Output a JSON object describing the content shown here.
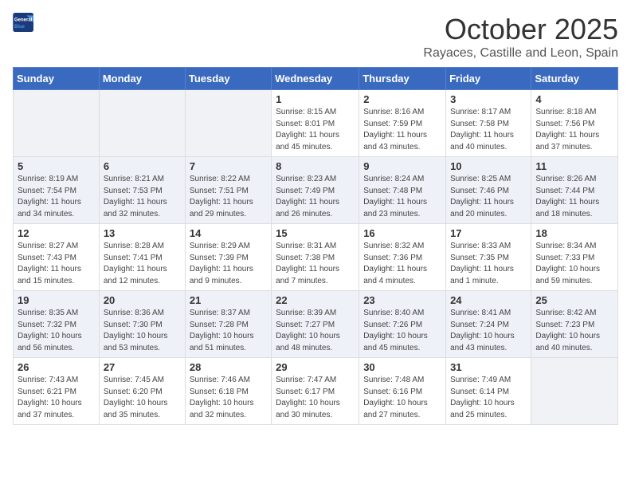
{
  "header": {
    "logo_line1": "General",
    "logo_line2": "Blue",
    "title": "October 2025",
    "subtitle": "Rayaces, Castille and Leon, Spain"
  },
  "weekdays": [
    "Sunday",
    "Monday",
    "Tuesday",
    "Wednesday",
    "Thursday",
    "Friday",
    "Saturday"
  ],
  "weeks": [
    [
      {
        "day": "",
        "info": ""
      },
      {
        "day": "",
        "info": ""
      },
      {
        "day": "",
        "info": ""
      },
      {
        "day": "1",
        "info": "Sunrise: 8:15 AM\nSunset: 8:01 PM\nDaylight: 11 hours and 45 minutes."
      },
      {
        "day": "2",
        "info": "Sunrise: 8:16 AM\nSunset: 7:59 PM\nDaylight: 11 hours and 43 minutes."
      },
      {
        "day": "3",
        "info": "Sunrise: 8:17 AM\nSunset: 7:58 PM\nDaylight: 11 hours and 40 minutes."
      },
      {
        "day": "4",
        "info": "Sunrise: 8:18 AM\nSunset: 7:56 PM\nDaylight: 11 hours and 37 minutes."
      }
    ],
    [
      {
        "day": "5",
        "info": "Sunrise: 8:19 AM\nSunset: 7:54 PM\nDaylight: 11 hours and 34 minutes."
      },
      {
        "day": "6",
        "info": "Sunrise: 8:21 AM\nSunset: 7:53 PM\nDaylight: 11 hours and 32 minutes."
      },
      {
        "day": "7",
        "info": "Sunrise: 8:22 AM\nSunset: 7:51 PM\nDaylight: 11 hours and 29 minutes."
      },
      {
        "day": "8",
        "info": "Sunrise: 8:23 AM\nSunset: 7:49 PM\nDaylight: 11 hours and 26 minutes."
      },
      {
        "day": "9",
        "info": "Sunrise: 8:24 AM\nSunset: 7:48 PM\nDaylight: 11 hours and 23 minutes."
      },
      {
        "day": "10",
        "info": "Sunrise: 8:25 AM\nSunset: 7:46 PM\nDaylight: 11 hours and 20 minutes."
      },
      {
        "day": "11",
        "info": "Sunrise: 8:26 AM\nSunset: 7:44 PM\nDaylight: 11 hours and 18 minutes."
      }
    ],
    [
      {
        "day": "12",
        "info": "Sunrise: 8:27 AM\nSunset: 7:43 PM\nDaylight: 11 hours and 15 minutes."
      },
      {
        "day": "13",
        "info": "Sunrise: 8:28 AM\nSunset: 7:41 PM\nDaylight: 11 hours and 12 minutes."
      },
      {
        "day": "14",
        "info": "Sunrise: 8:29 AM\nSunset: 7:39 PM\nDaylight: 11 hours and 9 minutes."
      },
      {
        "day": "15",
        "info": "Sunrise: 8:31 AM\nSunset: 7:38 PM\nDaylight: 11 hours and 7 minutes."
      },
      {
        "day": "16",
        "info": "Sunrise: 8:32 AM\nSunset: 7:36 PM\nDaylight: 11 hours and 4 minutes."
      },
      {
        "day": "17",
        "info": "Sunrise: 8:33 AM\nSunset: 7:35 PM\nDaylight: 11 hours and 1 minute."
      },
      {
        "day": "18",
        "info": "Sunrise: 8:34 AM\nSunset: 7:33 PM\nDaylight: 10 hours and 59 minutes."
      }
    ],
    [
      {
        "day": "19",
        "info": "Sunrise: 8:35 AM\nSunset: 7:32 PM\nDaylight: 10 hours and 56 minutes."
      },
      {
        "day": "20",
        "info": "Sunrise: 8:36 AM\nSunset: 7:30 PM\nDaylight: 10 hours and 53 minutes."
      },
      {
        "day": "21",
        "info": "Sunrise: 8:37 AM\nSunset: 7:28 PM\nDaylight: 10 hours and 51 minutes."
      },
      {
        "day": "22",
        "info": "Sunrise: 8:39 AM\nSunset: 7:27 PM\nDaylight: 10 hours and 48 minutes."
      },
      {
        "day": "23",
        "info": "Sunrise: 8:40 AM\nSunset: 7:26 PM\nDaylight: 10 hours and 45 minutes."
      },
      {
        "day": "24",
        "info": "Sunrise: 8:41 AM\nSunset: 7:24 PM\nDaylight: 10 hours and 43 minutes."
      },
      {
        "day": "25",
        "info": "Sunrise: 8:42 AM\nSunset: 7:23 PM\nDaylight: 10 hours and 40 minutes."
      }
    ],
    [
      {
        "day": "26",
        "info": "Sunrise: 7:43 AM\nSunset: 6:21 PM\nDaylight: 10 hours and 37 minutes."
      },
      {
        "day": "27",
        "info": "Sunrise: 7:45 AM\nSunset: 6:20 PM\nDaylight: 10 hours and 35 minutes."
      },
      {
        "day": "28",
        "info": "Sunrise: 7:46 AM\nSunset: 6:18 PM\nDaylight: 10 hours and 32 minutes."
      },
      {
        "day": "29",
        "info": "Sunrise: 7:47 AM\nSunset: 6:17 PM\nDaylight: 10 hours and 30 minutes."
      },
      {
        "day": "30",
        "info": "Sunrise: 7:48 AM\nSunset: 6:16 PM\nDaylight: 10 hours and 27 minutes."
      },
      {
        "day": "31",
        "info": "Sunrise: 7:49 AM\nSunset: 6:14 PM\nDaylight: 10 hours and 25 minutes."
      },
      {
        "day": "",
        "info": ""
      }
    ]
  ]
}
